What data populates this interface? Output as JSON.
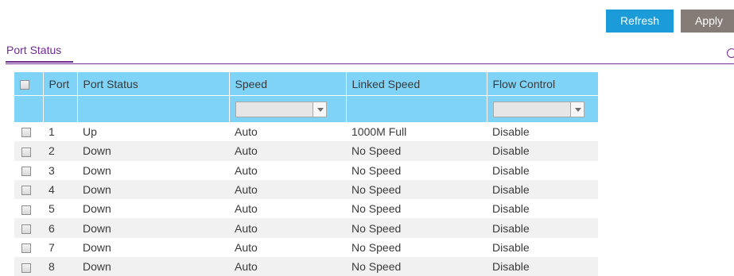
{
  "toolbar": {
    "refresh_label": "Refresh",
    "apply_label": "Apply"
  },
  "section": {
    "title": "Port Status"
  },
  "table": {
    "columns": [
      "Port",
      "Port Status",
      "Speed",
      "Linked Speed",
      "Flow Control"
    ],
    "filters": {
      "speed": "",
      "flow_control": ""
    },
    "rows": [
      {
        "port": "1",
        "status": "Up",
        "speed": "Auto",
        "linked_speed": "1000M Full",
        "flow_control": "Disable"
      },
      {
        "port": "2",
        "status": "Down",
        "speed": "Auto",
        "linked_speed": "No Speed",
        "flow_control": "Disable"
      },
      {
        "port": "3",
        "status": "Down",
        "speed": "Auto",
        "linked_speed": "No Speed",
        "flow_control": "Disable"
      },
      {
        "port": "4",
        "status": "Down",
        "speed": "Auto",
        "linked_speed": "No Speed",
        "flow_control": "Disable"
      },
      {
        "port": "5",
        "status": "Down",
        "speed": "Auto",
        "linked_speed": "No Speed",
        "flow_control": "Disable"
      },
      {
        "port": "6",
        "status": "Down",
        "speed": "Auto",
        "linked_speed": "No Speed",
        "flow_control": "Disable"
      },
      {
        "port": "7",
        "status": "Down",
        "speed": "Auto",
        "linked_speed": "No Speed",
        "flow_control": "Disable"
      },
      {
        "port": "8",
        "status": "Down",
        "speed": "Auto",
        "linked_speed": "No Speed",
        "flow_control": "Disable"
      }
    ]
  },
  "colors": {
    "accent": "#6f2c91",
    "refresh_button": "#1b9bd8",
    "apply_button": "#857c77",
    "table_header": "#7fd3f7"
  }
}
